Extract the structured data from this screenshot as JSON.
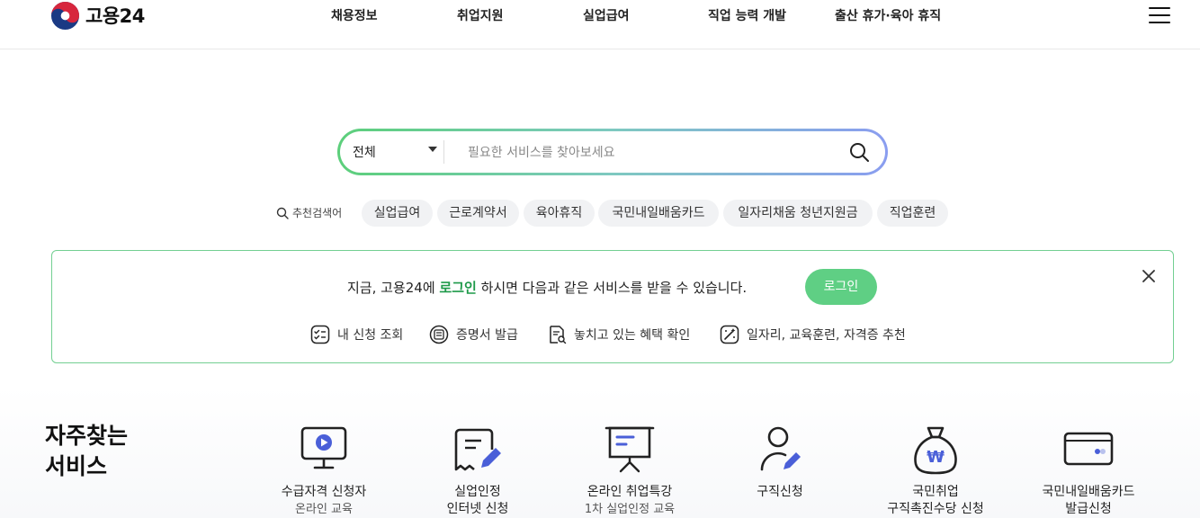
{
  "header": {
    "logo_text": "고용24",
    "nav": [
      "채용정보",
      "취업지원",
      "실업급여",
      "직업 능력 개발",
      "출산 휴가·육아 휴직"
    ]
  },
  "search": {
    "scope": "전체",
    "placeholder": "필요한 서비스를 찾아보세요",
    "value": ""
  },
  "recommended": {
    "label": "추천검색어",
    "chips": [
      "실업급여",
      "근로계약서",
      "육아휴직",
      "국민내일배움카드",
      "일자리채움 청년지원금",
      "직업훈련"
    ]
  },
  "login_panel": {
    "msg_before": "지금, 고용24에 ",
    "msg_highlight": "로그인",
    "msg_after": " 하시면 다음과 같은 서비스를 받을 수 있습니다.",
    "button": "로그인",
    "services": [
      "내 신청 조회",
      "증명서 발급",
      "놓치고 있는 혜택 확인",
      "일자리, 교육훈련, 자격증 추천"
    ]
  },
  "frequent": {
    "title_line1": "자주찾는",
    "title_line2": "서비스",
    "items": [
      {
        "line1": "수급자격 신청자",
        "line2": "온라인 교육"
      },
      {
        "line1": "실업인정",
        "line2": "인터넷 신청"
      },
      {
        "line1": "온라인 취업특강",
        "line2": "1차 실업인정 교육"
      },
      {
        "line1": "구직신청",
        "line2": ""
      },
      {
        "line1": "국민취업",
        "line2": "구직촉진수당 신청"
      },
      {
        "line1": "국민내일배움카드",
        "line2": "발급신청"
      }
    ]
  },
  "colors": {
    "brand_green": "#5fcf84",
    "highlight_green": "#1f9a4a",
    "accent_blue": "#4a5fd8",
    "chip_bg": "#f1f2f4"
  }
}
